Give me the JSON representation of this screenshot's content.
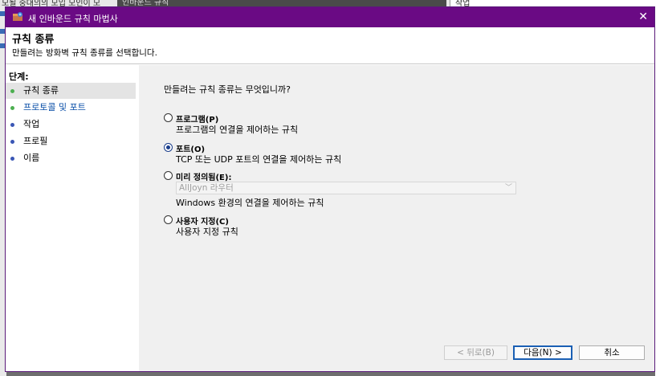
{
  "background": {
    "left_title": "모될 중대의의 모입 모인이 모",
    "center_title": "인바운드 규칙",
    "right_title": "작업"
  },
  "window": {
    "title": "새 인바운드 규칙 마법사",
    "close_glyph": "✕"
  },
  "header": {
    "title": "규칙 종류",
    "subtitle": "만들려는 방화벽 규칙 종류를 선택합니다."
  },
  "steps": {
    "label": "단계:",
    "items": [
      {
        "label": "규칙 종류",
        "color": "#4caf50"
      },
      {
        "label": "프로토콜 및 포트",
        "color": "#4caf50"
      },
      {
        "label": "작업",
        "color": "#3a56b5"
      },
      {
        "label": "프로필",
        "color": "#3a56b5"
      },
      {
        "label": "이름",
        "color": "#3a56b5"
      }
    ]
  },
  "content": {
    "question": "만들려는 규칙 종류는 무엇입니까?",
    "options": [
      {
        "label": "프로그램(P)",
        "desc": "프로그램의 연결을 제어하는 규칙",
        "selected": false
      },
      {
        "label": "포트(O)",
        "desc": "TCP 또는 UDP 포트의 연결을 제어하는 규칙",
        "selected": true
      },
      {
        "label": "미리 정의됨(E):",
        "select_value": "AllJoyn 라우터",
        "desc": "Windows 환경의 연결을 제어하는 규칙",
        "selected": false
      },
      {
        "label": "사용자 지정(C)",
        "desc": "사용자 지정 규칙",
        "selected": false
      }
    ]
  },
  "buttons": {
    "back": "< 뒤로(B)",
    "next": "다음(N) >",
    "cancel": "취소"
  }
}
